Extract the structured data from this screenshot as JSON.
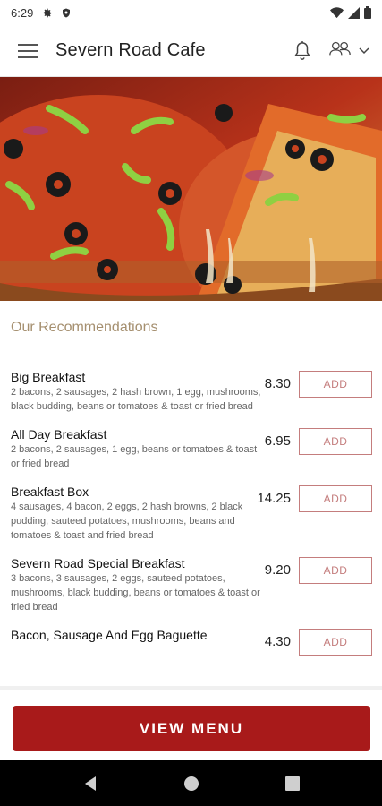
{
  "status_bar": {
    "time": "6:29",
    "icons": [
      "gear-icon",
      "shield-icon",
      "wifi-icon",
      "signal-icon",
      "battery-icon"
    ]
  },
  "app_bar": {
    "title": "Severn Road Cafe",
    "icons": [
      "hamburger-menu-icon",
      "bell-icon",
      "people-icon",
      "chevron-down-icon"
    ]
  },
  "hero": {
    "description_icon": "pizza-photo"
  },
  "recommendations": {
    "title": "Our Recommendations",
    "items": [
      {
        "name": "Big Breakfast",
        "desc": "2 bacons, 2 sausages, 2 hash brown, 1 egg, mushrooms, black budding, beans or tomatoes & toast or fried bread",
        "price": "8.30",
        "add_label": "ADD"
      },
      {
        "name": "All Day Breakfast",
        "desc": "2 bacons, 2 sausages, 1 egg, beans or tomatoes & toast or fried bread",
        "price": "6.95",
        "add_label": "ADD"
      },
      {
        "name": "Breakfast Box",
        "desc": "4 sausages, 4 bacon, 2 eggs, 2 hash browns, 2 black pudding, sauteed potatoes, mushrooms, beans and tomatoes & toast and fried bread",
        "price": "14.25",
        "add_label": "ADD"
      },
      {
        "name": "Severn Road Special Breakfast",
        "desc": "3 bacons, 3 sausages, 2 eggs, sauteed potatoes, mushrooms, black budding, beans or tomatoes & toast or fried bread",
        "price": "9.20",
        "add_label": "ADD"
      },
      {
        "name": "Bacon, Sausage And Egg Baguette",
        "desc": "",
        "price": "4.30",
        "add_label": "ADD"
      }
    ]
  },
  "view_menu": {
    "label": "VIEW MENU"
  },
  "colors": {
    "accent": "#a81a1a",
    "section_title": "#a58f6f",
    "add_border": "#c47d7d"
  },
  "nav_bar": {
    "icons": [
      "back-icon",
      "home-icon",
      "recents-icon"
    ]
  }
}
